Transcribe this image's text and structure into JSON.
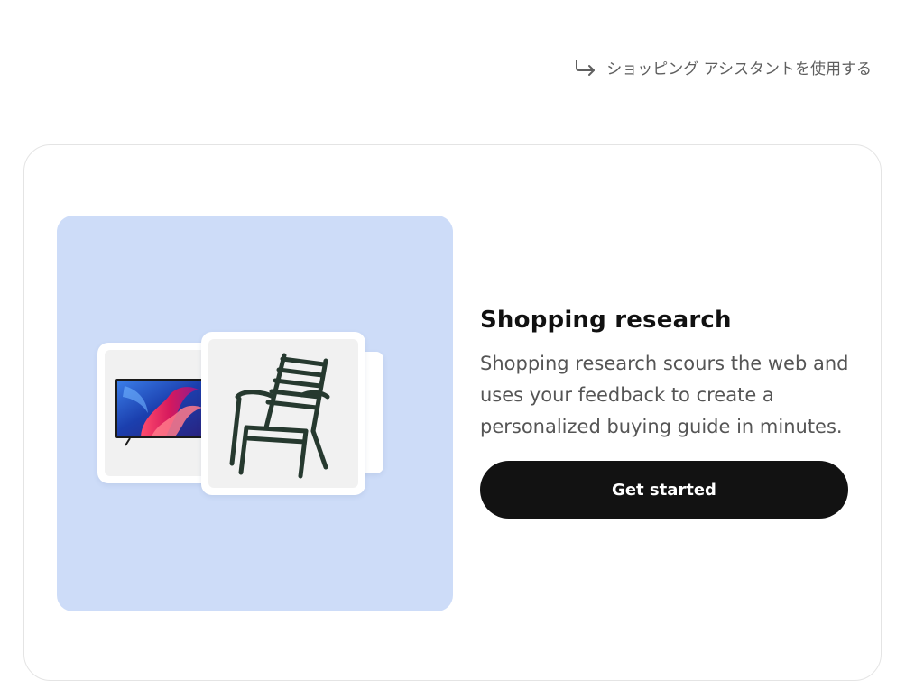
{
  "header": {
    "action_label": "ショッピング アシスタントを使用する",
    "action_icon": "return-arrow-icon"
  },
  "card": {
    "title": "Shopping research",
    "description": "Shopping research scours the web and uses your feedback to create a personalized buying guide in minutes.",
    "cta_label": "Get started"
  },
  "illustration": {
    "background_color": "#cddcf8",
    "items": [
      "tv-image",
      "chair-image"
    ]
  },
  "colors": {
    "cta_background": "#121212",
    "cta_text": "#ffffff",
    "title_text": "#111111",
    "body_text": "#555555",
    "link_text": "#5f5f5f"
  }
}
